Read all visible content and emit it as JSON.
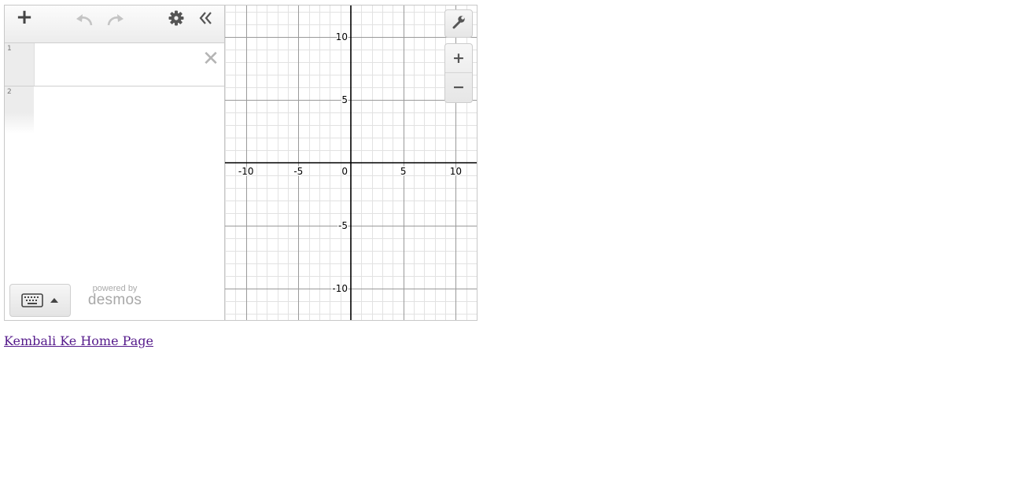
{
  "expressions": [
    {
      "number": "1"
    },
    {
      "number": "2"
    }
  ],
  "toolbar": {
    "add_icon": "plus-icon",
    "undo_icon": "undo-icon",
    "redo_icon": "redo-icon",
    "settings_icon": "gear-icon",
    "collapse_icon": "double-chevron-left-icon"
  },
  "branding": {
    "powered_by": "powered by",
    "logo_text": "desmos"
  },
  "graph": {
    "x_range": [
      -12,
      12
    ],
    "y_range": [
      -12.5,
      12.5
    ],
    "major_step": 5,
    "minor_step": 1,
    "grid": true,
    "x_tick_labels": [
      {
        "value": -10,
        "label": "-10"
      },
      {
        "value": -5,
        "label": "-5"
      },
      {
        "value": 5,
        "label": "5"
      },
      {
        "value": 10,
        "label": "10"
      }
    ],
    "y_tick_labels": [
      {
        "value": 10,
        "label": "10"
      },
      {
        "value": 5,
        "label": "5"
      },
      {
        "value": -5,
        "label": "-5"
      },
      {
        "value": -10,
        "label": "-10"
      }
    ],
    "origin_label": "0",
    "colors": {
      "minor": "#e2e2e2",
      "major": "#9a9a9a",
      "axis": "#000000"
    }
  },
  "graph_controls": {
    "wrench_icon": "wrench-icon",
    "zoom_in_icon": "plus-icon",
    "zoom_out_icon": "minus-icon"
  },
  "keyboard_button": {
    "icon": "keyboard-icon",
    "caret_icon": "caret-up-icon"
  },
  "home_link": {
    "text": "Kembali Ke Home Page"
  }
}
